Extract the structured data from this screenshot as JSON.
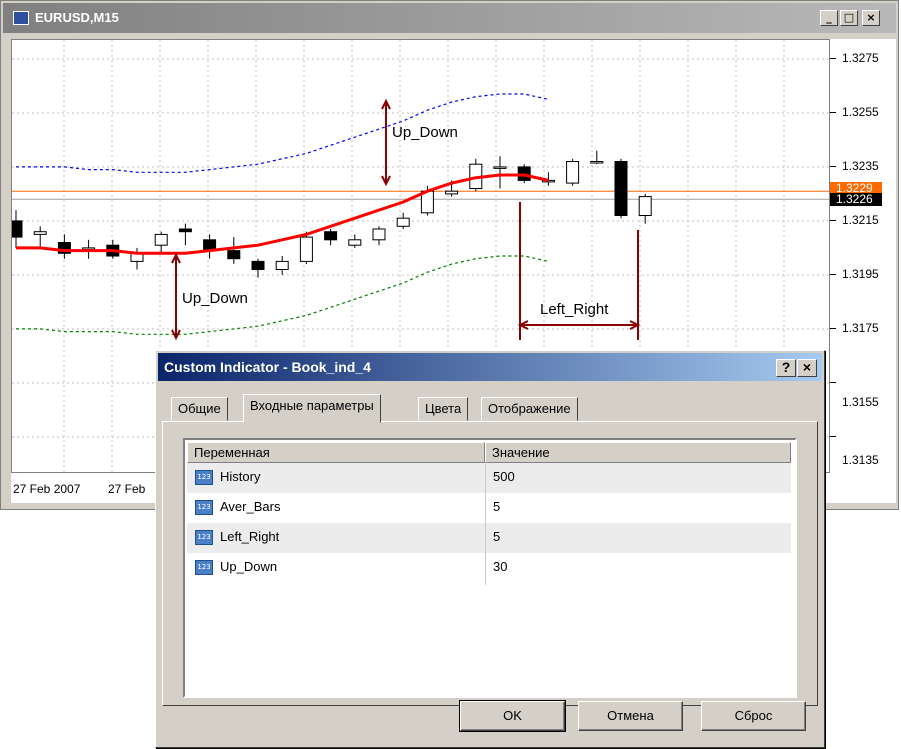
{
  "chart_window": {
    "title": "EURUSD,M15",
    "buttons": {
      "minimize": "_",
      "maximize": "□",
      "close": "×"
    }
  },
  "chart": {
    "price_labels": [
      "1.3275",
      "1.3255",
      "1.3235",
      "1.3215",
      "1.3195",
      "1.3175",
      "1.3155",
      "1.3135"
    ],
    "price_tags": [
      {
        "text": "1.3229",
        "color": "#ff6a00"
      },
      {
        "text": "1.3226",
        "color": "#000000"
      }
    ],
    "time_labels": [
      "27 Feb 2007",
      "27 Feb"
    ],
    "annotations": {
      "up_down_top": "Up_Down",
      "up_down_bottom": "Up_Down",
      "left_right": "Left_Right"
    },
    "colors": {
      "moving_average": "#ff0000",
      "upper_band": "#0000ff",
      "lower_band": "#008000",
      "annotation_arrows": "#8b0000",
      "ask_line": "#ff6a00"
    }
  },
  "chart_data": {
    "type": "candlestick",
    "ylim": [
      1.3125,
      1.3285
    ],
    "candles": [
      {
        "o": 1.3218,
        "h": 1.3222,
        "l": 1.3208,
        "c": 1.3212
      },
      {
        "o": 1.3213,
        "h": 1.3216,
        "l": 1.3208,
        "c": 1.3214
      },
      {
        "o": 1.321,
        "h": 1.3213,
        "l": 1.3204,
        "c": 1.3206
      },
      {
        "o": 1.3208,
        "h": 1.3211,
        "l": 1.3204,
        "c": 1.3208
      },
      {
        "o": 1.3209,
        "h": 1.3211,
        "l": 1.3204,
        "c": 1.3205
      },
      {
        "o": 1.3203,
        "h": 1.3208,
        "l": 1.32,
        "c": 1.3206
      },
      {
        "o": 1.3209,
        "h": 1.3214,
        "l": 1.3206,
        "c": 1.3213
      },
      {
        "o": 1.3215,
        "h": 1.3217,
        "l": 1.3209,
        "c": 1.3214
      },
      {
        "o": 1.3211,
        "h": 1.3213,
        "l": 1.3204,
        "c": 1.3207
      },
      {
        "o": 1.3207,
        "h": 1.3212,
        "l": 1.3202,
        "c": 1.3204
      },
      {
        "o": 1.3203,
        "h": 1.3204,
        "l": 1.3197,
        "c": 1.32
      },
      {
        "o": 1.32,
        "h": 1.3205,
        "l": 1.3198,
        "c": 1.3203
      },
      {
        "o": 1.3203,
        "h": 1.3214,
        "l": 1.3202,
        "c": 1.3212
      },
      {
        "o": 1.3214,
        "h": 1.3215,
        "l": 1.3209,
        "c": 1.3211
      },
      {
        "o": 1.3209,
        "h": 1.3213,
        "l": 1.3208,
        "c": 1.3211
      },
      {
        "o": 1.3211,
        "h": 1.3216,
        "l": 1.3209,
        "c": 1.3215
      },
      {
        "o": 1.3216,
        "h": 1.3221,
        "l": 1.3215,
        "c": 1.3219
      },
      {
        "o": 1.3221,
        "h": 1.3231,
        "l": 1.322,
        "c": 1.3229
      },
      {
        "o": 1.3228,
        "h": 1.3233,
        "l": 1.3227,
        "c": 1.3229
      },
      {
        "o": 1.323,
        "h": 1.3241,
        "l": 1.3229,
        "c": 1.3239
      },
      {
        "o": 1.3238,
        "h": 1.3242,
        "l": 1.323,
        "c": 1.3238
      },
      {
        "o": 1.3238,
        "h": 1.3239,
        "l": 1.3232,
        "c": 1.3233
      },
      {
        "o": 1.3233,
        "h": 1.3236,
        "l": 1.3231,
        "c": 1.3233
      },
      {
        "o": 1.3232,
        "h": 1.3241,
        "l": 1.3231,
        "c": 1.324
      },
      {
        "o": 1.324,
        "h": 1.3244,
        "l": 1.3239,
        "c": 1.324
      },
      {
        "o": 1.324,
        "h": 1.3241,
        "l": 1.3219,
        "c": 1.322
      },
      {
        "o": 1.322,
        "h": 1.3228,
        "l": 1.3217,
        "c": 1.3227
      }
    ],
    "moving_average": [
      1.3208,
      1.3208,
      1.3207,
      1.3207,
      1.3207,
      1.3206,
      1.3206,
      1.3206,
      1.3207,
      1.3208,
      1.3209,
      1.3211,
      1.3213,
      1.3216,
      1.3219,
      1.3222,
      1.3225,
      1.3229,
      1.3232,
      1.3234,
      1.3235,
      1.3235,
      1.3233
    ],
    "upper_band": [
      1.3238,
      1.3238,
      1.3238,
      1.3237,
      1.3237,
      1.3236,
      1.3236,
      1.3236,
      1.3237,
      1.3238,
      1.3239,
      1.3241,
      1.3243,
      1.3246,
      1.3249,
      1.3252,
      1.3255,
      1.3259,
      1.3262,
      1.3264,
      1.3265,
      1.3265,
      1.3263
    ],
    "lower_band": [
      1.3178,
      1.3178,
      1.3177,
      1.3177,
      1.3177,
      1.3176,
      1.3176,
      1.3176,
      1.3177,
      1.3178,
      1.3179,
      1.3181,
      1.3183,
      1.3186,
      1.3189,
      1.3192,
      1.3195,
      1.3199,
      1.3202,
      1.3204,
      1.3205,
      1.3205,
      1.3203
    ],
    "ask_line": 1.3229,
    "bid_line": 1.3226
  },
  "dialog": {
    "title": "Custom Indicator - Book_ind_4",
    "help_button": "?",
    "close_button": "×",
    "tabs": [
      "Общие",
      "Входные параметры",
      "Цвета",
      "Отображение"
    ],
    "active_tab": "Входные параметры",
    "table": {
      "columns": [
        "Переменная",
        "Значение"
      ],
      "rows": [
        {
          "name": "History",
          "value": "500"
        },
        {
          "name": "Aver_Bars",
          "value": "5"
        },
        {
          "name": "Left_Right",
          "value": "5"
        },
        {
          "name": "Up_Down",
          "value": "30"
        }
      ],
      "row_icon": "123"
    },
    "buttons": {
      "ok": "OK",
      "cancel": "Отмена",
      "reset": "Сброс"
    }
  }
}
